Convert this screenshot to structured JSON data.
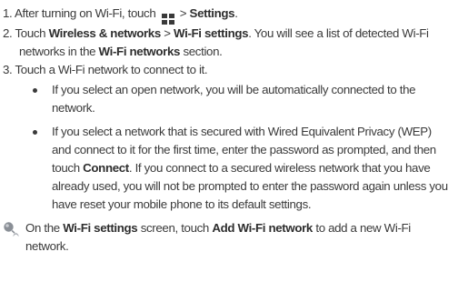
{
  "steps": [
    {
      "number": "1.",
      "text_a": "After turning on Wi-Fi, touch",
      "text_b": ">",
      "bold_a": "Settings",
      "text_c": "."
    },
    {
      "number": "2.",
      "text_a": "Touch",
      "bold_a": "Wireless & networks",
      "text_b": ">",
      "bold_b": "Wi-Fi settings",
      "text_c": ". You will see a list of detected Wi-Fi",
      "text_d": "networks in the",
      "bold_c": "Wi-Fi networks",
      "text_e": "section."
    },
    {
      "number": "3.",
      "text_a": "Touch a Wi-Fi network to connect to it."
    }
  ],
  "bullets": [
    {
      "lines": [
        "If you select an open network, you will be automatically connected to the",
        "network."
      ]
    },
    {
      "line1": "If you select a network that is secured with Wired Equivalent Privacy (WEP)",
      "line2": "and connect to it for the first time, enter the password as prompted, and then",
      "line3_a": "touch",
      "line3_bold": "Connect",
      "line3_b": ". If you connect to a secured wireless network that you have",
      "line4": "already used, you will not be prompted to enter the password again unless you",
      "line5": "have reset your mobile phone to its default settings."
    }
  ],
  "note": {
    "icon": "tip-icon",
    "text_a": "On the",
    "bold_a": "Wi-Fi settings",
    "text_b": "screen, touch",
    "bold_b": "Add Wi-Fi network",
    "text_c": "to add a new Wi-Fi",
    "text_d": "network."
  },
  "colors": {
    "text": "#3a3a3a",
    "icon_grey": "#8a8f96"
  }
}
